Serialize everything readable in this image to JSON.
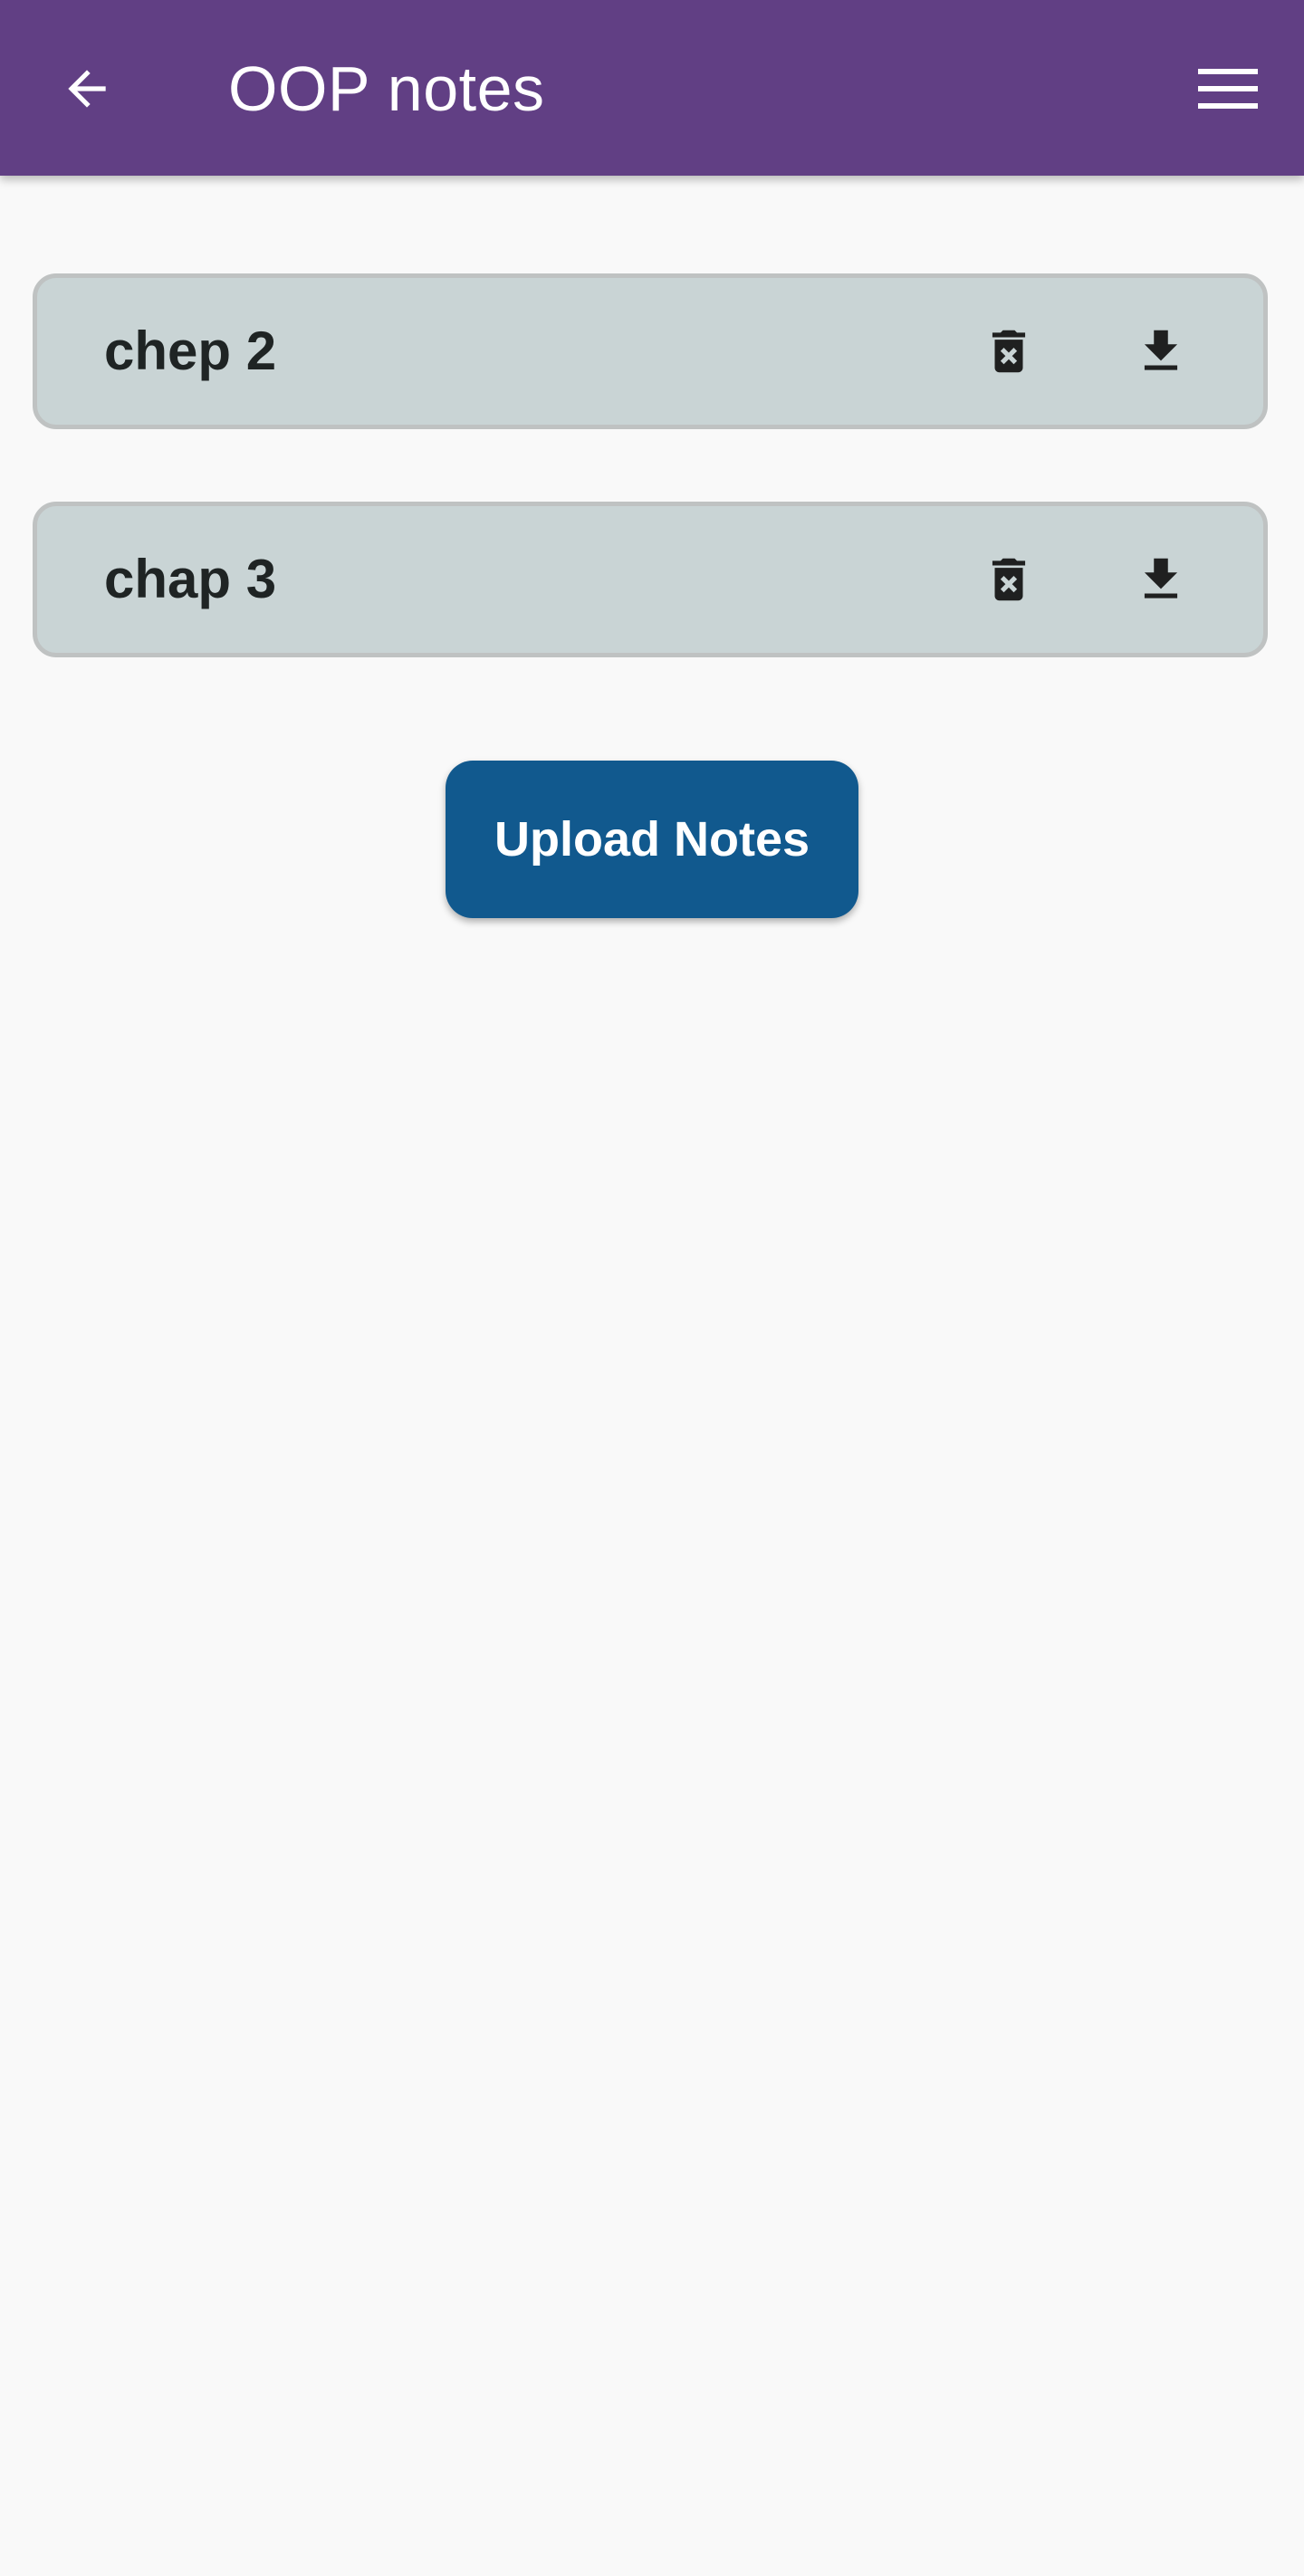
{
  "app_bar": {
    "title": "OOP notes",
    "background_color": "#613f84",
    "back_icon": "arrow-back-icon",
    "menu_icon": "hamburger-menu-icon"
  },
  "notes": [
    {
      "title": "chep 2",
      "delete_icon": "delete-forever-icon",
      "download_icon": "download-icon"
    },
    {
      "title": "chap 3",
      "delete_icon": "delete-forever-icon",
      "download_icon": "download-icon"
    }
  ],
  "upload_button": {
    "label": "Upload Notes",
    "background_color": "#11598e"
  },
  "colors": {
    "card_background": "#c9d4d5",
    "page_background": "#f9f9f9"
  }
}
